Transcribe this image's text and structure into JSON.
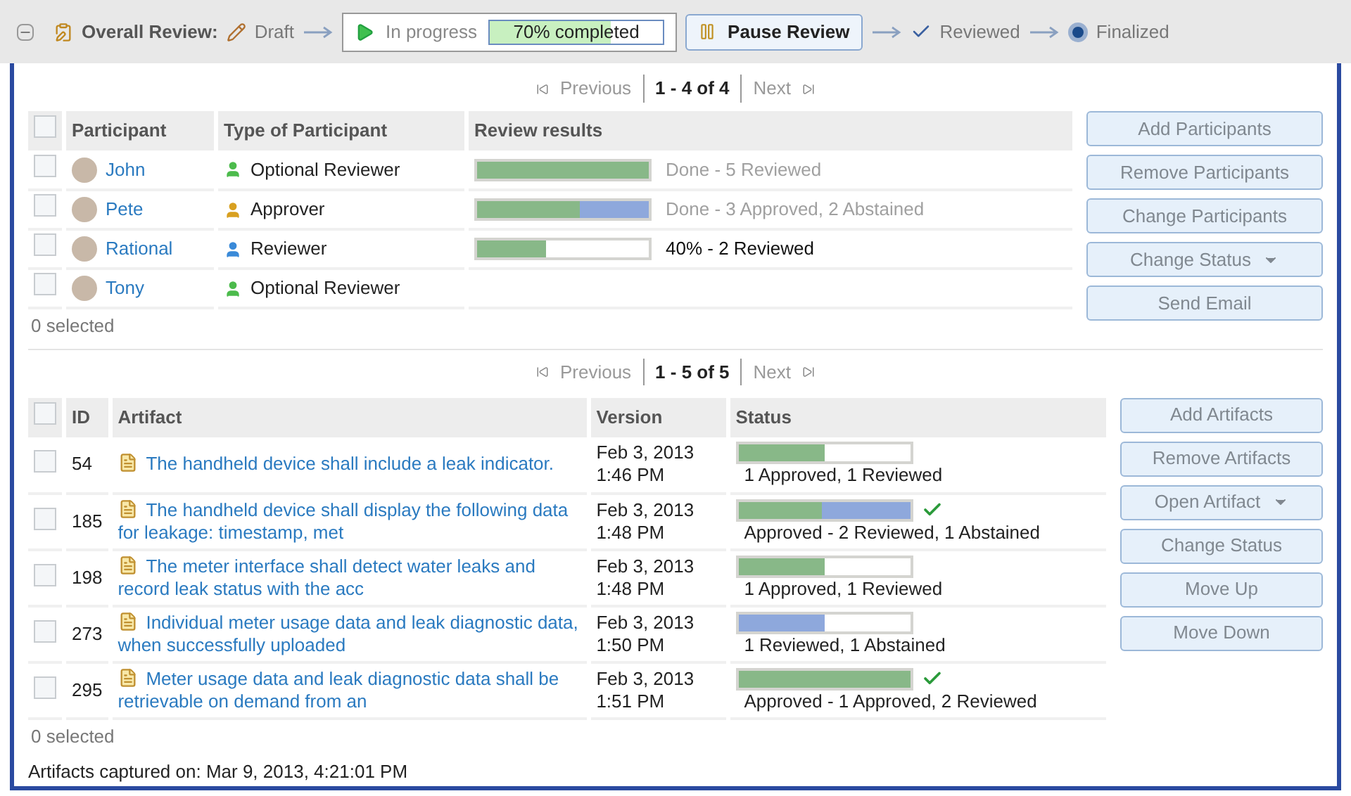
{
  "header": {
    "title": "Overall Review:",
    "steps": [
      {
        "kind": "draft",
        "label": "Draft"
      },
      {
        "kind": "current",
        "label": "In progress",
        "progress_text": "70% completed",
        "level": 0.7
      },
      {
        "kind": "button",
        "label": "Pause Review"
      },
      {
        "kind": "reviewed",
        "label": "Reviewed"
      },
      {
        "kind": "finalized",
        "label": "Finalized"
      }
    ]
  },
  "participants": {
    "pager": {
      "previous": "Previous",
      "range": "1 - 4 of 4",
      "next": "Next"
    },
    "columns": [
      "Participant",
      "Type of Participant",
      "Review results"
    ],
    "select_all": {
      "checked": false
    },
    "rows": [
      {
        "name": "John",
        "type": "Optional Reviewer",
        "kind": "optional",
        "checked": false,
        "done": true,
        "result": "Done - 5 Reviewed",
        "segments": [
          {
            "color": "#88b888",
            "level": 1
          }
        ]
      },
      {
        "name": "Pete",
        "type": "Approver",
        "kind": "approver",
        "checked": false,
        "done": true,
        "result": "Done - 3 Approved, 2 Abstained",
        "segments": [
          {
            "color": "#88b888",
            "level": 0.6
          },
          {
            "color": "#8ea8dc",
            "level": 0.4
          }
        ]
      },
      {
        "name": "Rational",
        "type": "Reviewer",
        "kind": "reviewer",
        "checked": false,
        "done": false,
        "result": "40% - 2 Reviewed",
        "segments": [
          {
            "color": "#88b888",
            "level": 0.4
          }
        ]
      },
      {
        "name": "Tony",
        "type": "Optional Reviewer",
        "kind": "optional",
        "checked": false
      }
    ],
    "selected_count": "0 selected",
    "buttons": [
      {
        "label": "Add Participants",
        "menu": false
      },
      {
        "label": "Remove Participants",
        "menu": false
      },
      {
        "label": "Change Participants",
        "menu": false
      },
      {
        "label": "Change Status",
        "menu": true
      },
      {
        "label": "Send Email",
        "menu": false
      }
    ]
  },
  "artifacts": {
    "pager": {
      "previous": "Previous",
      "range": "1 - 5 of 5",
      "next": "Next"
    },
    "columns": [
      "ID",
      "Artifact",
      "Version",
      "Status"
    ],
    "select_all": {
      "checked": false
    },
    "rows": [
      {
        "checked": false,
        "id": "54",
        "title": "The handheld device shall include a leak indicator.",
        "version": [
          "Feb 3, 2013",
          "1:46 PM"
        ],
        "approved": false,
        "status": "1 Approved, 1 Reviewed",
        "segments": [
          {
            "color": "#88b888",
            "level": 0.5
          }
        ]
      },
      {
        "checked": false,
        "id": "185",
        "title": "The handheld device shall display the following data for leakage: timestamp, met",
        "version": [
          "Feb 3, 2013",
          "1:48 PM"
        ],
        "approved": true,
        "status": "Approved - 2 Reviewed, 1 Abstained",
        "segments": [
          {
            "color": "#88b888",
            "level": 0.49
          },
          {
            "color": "#8ea8dc",
            "level": 0.51
          }
        ]
      },
      {
        "checked": false,
        "id": "198",
        "title": "The meter interface shall detect water leaks and record leak status with the acc",
        "version": [
          "Feb 3, 2013",
          "1:48 PM"
        ],
        "approved": false,
        "status": "1 Approved, 1 Reviewed",
        "segments": [
          {
            "color": "#88b888",
            "level": 0.5
          }
        ]
      },
      {
        "checked": false,
        "id": "273",
        "title": "Individual meter usage data and leak diagnostic data, when successfully uploaded",
        "version": [
          "Feb 3, 2013",
          "1:50 PM"
        ],
        "approved": false,
        "status": "1 Reviewed, 1 Abstained",
        "segments": [
          {
            "color": "#8ea8dc",
            "level": 0.5
          }
        ]
      },
      {
        "checked": false,
        "id": "295",
        "title": "Meter usage data and leak diagnostic data shall be retrievable on demand from an",
        "version": [
          "Feb 3, 2013",
          "1:51 PM"
        ],
        "approved": true,
        "status": "Approved - 1 Approved, 2 Reviewed",
        "segments": [
          {
            "color": "#88b888",
            "level": 1
          }
        ]
      }
    ],
    "selected_count": "0 selected",
    "captured": "Artifacts captured on: Mar 9, 2013, 4:21:01 PM",
    "buttons": [
      {
        "label": "Add Artifacts",
        "menu": false
      },
      {
        "label": "Remove Artifacts",
        "menu": false
      },
      {
        "label": "Open Artifact",
        "menu": true
      },
      {
        "label": "Change Status",
        "menu": false
      },
      {
        "label": "Move Up",
        "menu": false
      },
      {
        "label": "Move Down",
        "menu": false
      }
    ]
  }
}
